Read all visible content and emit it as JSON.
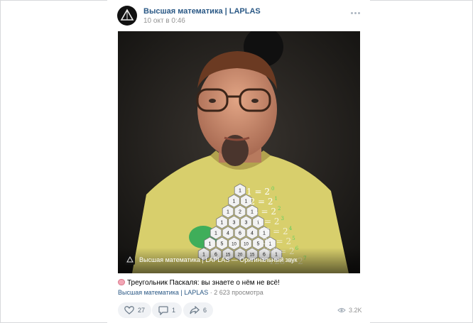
{
  "post": {
    "author": "Высшая математика | LAPLAS",
    "time": "10 окт в 0:46",
    "video": {
      "caption": "Высшая математика | LAPLAS — Оригинальный звук",
      "formulas": [
        "1 = 2",
        "2 = 2",
        "4 = 2",
        "8 = 2",
        "16 = 2",
        "32 = 2",
        "64 = 2",
        "128 = 2"
      ],
      "exponents": [
        "0",
        "1",
        "2",
        "3",
        "4",
        "5",
        "6",
        "7"
      ],
      "pascal_rows": [
        [
          "1"
        ],
        [
          "1",
          "1"
        ],
        [
          "1",
          "2",
          "1"
        ],
        [
          "1",
          "3",
          "3",
          "1"
        ],
        [
          "1",
          "4",
          "6",
          "4",
          "1"
        ],
        [
          "1",
          "5",
          "10",
          "10",
          "5",
          "1"
        ],
        [
          "1",
          "6",
          "15",
          "20",
          "15",
          "6",
          "1"
        ]
      ]
    },
    "text": "Треугольник Паскаля: вы знаете о нём не всё!",
    "meta_author": "Высшая математика | LAPLAS",
    "meta_views": "2 623 просмотра",
    "likes": "27",
    "comments": "1",
    "shares": "6",
    "views": "3.2K"
  },
  "icons": {
    "avatar": "laplas-triangle-logo",
    "more": "ellipsis-icon",
    "like": "heart-icon",
    "comment": "comment-icon",
    "share": "share-arrow-icon",
    "views": "eye-icon",
    "emoji": "brain-emoji"
  },
  "colors": {
    "link": "#2a5885",
    "muted": "#939393",
    "button_bg": "#f0f2f5",
    "formula_green": "#5ccf5c"
  }
}
